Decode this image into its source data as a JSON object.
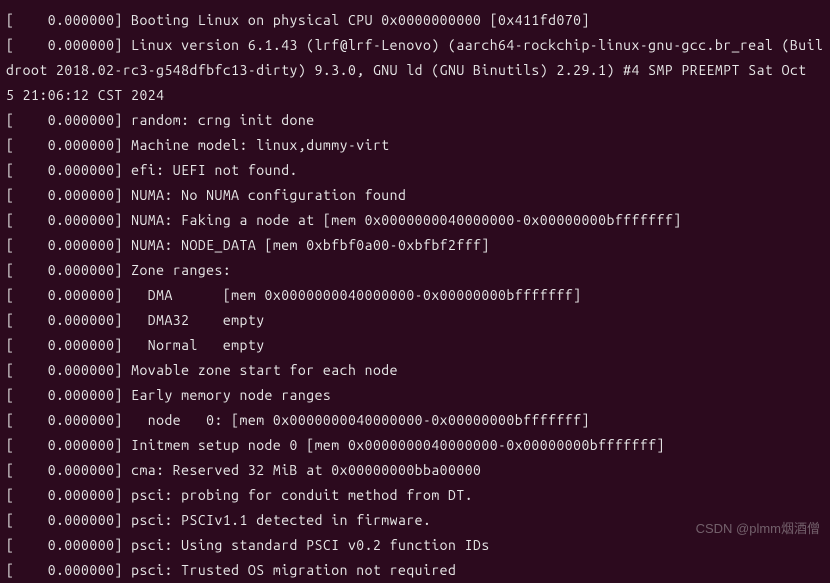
{
  "lines": [
    "[    0.000000] Booting Linux on physical CPU 0x0000000000 [0x411fd070]",
    "[    0.000000] Linux version 6.1.43 (lrf@lrf-Lenovo) (aarch64-rockchip-linux-gnu-gcc.br_real (Buildroot 2018.02-rc3-g548dfbfc13-dirty) 9.3.0, GNU ld (GNU Binutils) 2.29.1) #4 SMP PREEMPT Sat Oct  5 21:06:12 CST 2024",
    "[    0.000000] random: crng init done",
    "[    0.000000] Machine model: linux,dummy-virt",
    "[    0.000000] efi: UEFI not found.",
    "[    0.000000] NUMA: No NUMA configuration found",
    "[    0.000000] NUMA: Faking a node at [mem 0x0000000040000000-0x00000000bfffffff]",
    "[    0.000000] NUMA: NODE_DATA [mem 0xbfbf0a00-0xbfbf2fff]",
    "[    0.000000] Zone ranges:",
    "[    0.000000]   DMA      [mem 0x0000000040000000-0x00000000bfffffff]",
    "[    0.000000]   DMA32    empty",
    "[    0.000000]   Normal   empty",
    "[    0.000000] Movable zone start for each node",
    "[    0.000000] Early memory node ranges",
    "[    0.000000]   node   0: [mem 0x0000000040000000-0x00000000bfffffff]",
    "[    0.000000] Initmem setup node 0 [mem 0x0000000040000000-0x00000000bfffffff]",
    "[    0.000000] cma: Reserved 32 MiB at 0x00000000bba00000",
    "[    0.000000] psci: probing for conduit method from DT.",
    "[    0.000000] psci: PSCIv1.1 detected in firmware.",
    "[    0.000000] psci: Using standard PSCI v0.2 function IDs",
    "[    0.000000] psci: Trusted OS migration not required"
  ],
  "watermark": "CSDN @plmm烟酒僧"
}
